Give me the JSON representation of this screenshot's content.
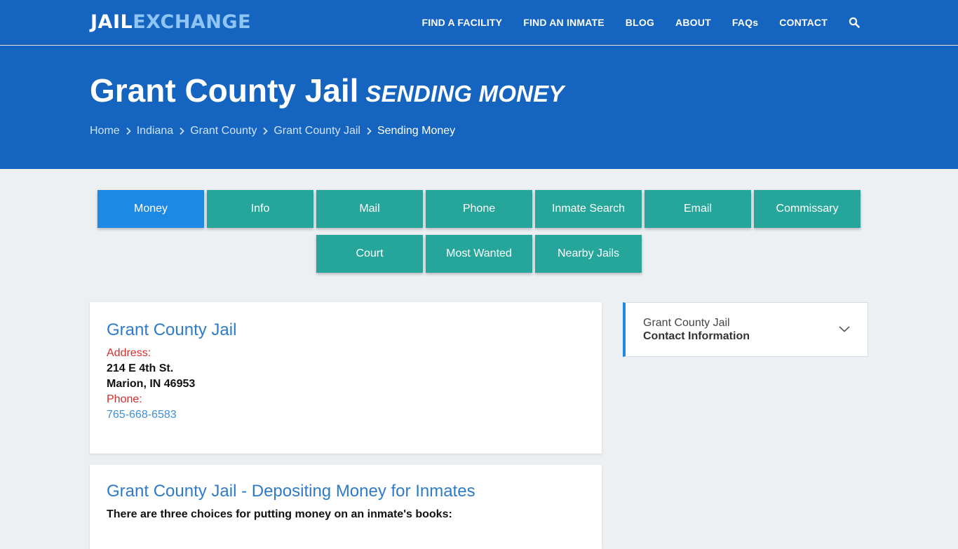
{
  "brand": {
    "part1": "JAIL",
    "part2": "EXCHANGE"
  },
  "nav": [
    {
      "label": "FIND A FACILITY"
    },
    {
      "label": "FIND AN INMATE"
    },
    {
      "label": "BLOG"
    },
    {
      "label": "ABOUT"
    },
    {
      "label": "FAQs"
    },
    {
      "label": "CONTACT"
    }
  ],
  "icons": {
    "search": "search-icon",
    "breadcrumb_separator": "chevron-right-icon",
    "expand": "chevron-down-icon"
  },
  "hero": {
    "title": "Grant County Jail",
    "subtitle": "SENDING MONEY"
  },
  "breadcrumb": [
    "Home",
    "Indiana",
    "Grant County",
    "Grant County Jail",
    "Sending Money"
  ],
  "tabs": {
    "row1": [
      "Money",
      "Info",
      "Mail",
      "Phone",
      "Inmate Search",
      "Email",
      "Commissary"
    ],
    "row2": [
      "Court",
      "Most Wanted",
      "Nearby Jails"
    ],
    "active": "Money"
  },
  "facility": {
    "name": "Grant County Jail",
    "address_label": "Address:",
    "address_line1": "214 E 4th St.",
    "address_line2": "Marion, IN 46953",
    "phone_label": "Phone:",
    "phone": "765-668-6583"
  },
  "deposit": {
    "heading": "Grant County Jail - Depositing Money for Inmates",
    "intro": "There are three choices for putting money on an inmate's books:"
  },
  "sidebar": {
    "line1": "Grant County Jail",
    "line2": "Contact Information"
  },
  "colors": {
    "header_blue": "#1565c0",
    "tab_teal": "#26a69a",
    "tab_active": "#1e88e5",
    "label_red": "#d32f2f",
    "link_blue": "#2f7bc9"
  }
}
